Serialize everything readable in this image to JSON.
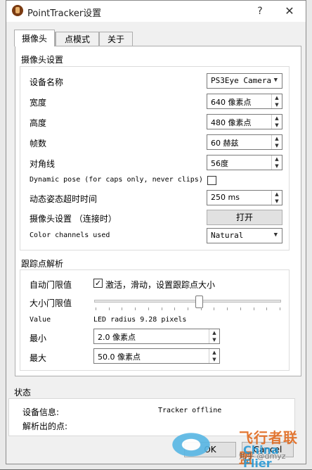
{
  "window": {
    "title": "PointTracker设置",
    "help": "?",
    "close": "✕"
  },
  "tabs": [
    {
      "label": "摄像头",
      "active": true
    },
    {
      "label": "点模式",
      "active": false
    },
    {
      "label": "关于",
      "active": false
    }
  ],
  "camera": {
    "title": "摄像头设置",
    "device_label": "设备名称",
    "device_value": "PS3Eye Camera",
    "width_label": "宽度",
    "width_value": "640 像素点",
    "height_label": "高度",
    "height_value": "480 像素点",
    "fps_label": "帧数",
    "fps_value": "60 赫兹",
    "diag_label": "对角线",
    "diag_value": "56度",
    "dynamic_pose_label": "Dynamic pose (for caps only, never clips)",
    "dynamic_pose_checked": false,
    "timeout_label": "动态姿态超时时间",
    "timeout_value": "250 ms",
    "settings_label": "摄像头设置 （连接时）",
    "open_button": "打开",
    "channels_label": "Color channels used",
    "channels_value": "Natural"
  },
  "tracking": {
    "title": "跟踪点解析",
    "auto_threshold_label": "自动门限值",
    "auto_threshold_checked": true,
    "auto_threshold_text": "激活，滑动，设置跟踪点大小",
    "size_threshold_label": "大小门限值",
    "slider_position": 0.56,
    "value_label": "Value",
    "value_text": "LED radius 9.28 pixels",
    "min_label": "最小",
    "min_value": "2.0 像素点",
    "max_label": "最大",
    "max_value": "50.0 像素点"
  },
  "status": {
    "title": "状态",
    "device_info_label": "设备信息:",
    "device_info_value": "Tracker offline",
    "points_label": "解析出的点:"
  },
  "footer": {
    "ok": "OK",
    "cancel": "Cancel"
  },
  "watermark": {
    "cn": "飞行者联盟",
    "en": "China Flier",
    "zhihu": "知乎 @dmyz"
  },
  "colors": {
    "accent_brand_orange": "#e0691e",
    "brand_blue": "#2a9ad6"
  }
}
